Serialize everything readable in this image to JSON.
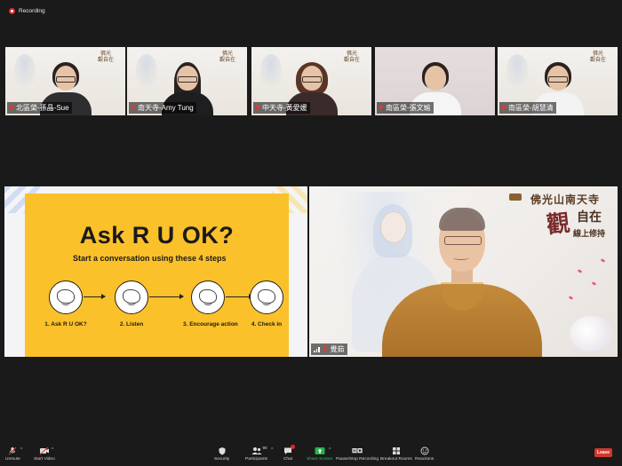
{
  "recording": {
    "label": "Recording"
  },
  "thumbnails": [
    {
      "name": "北區榮-孫晶-Sue"
    },
    {
      "name": "南天寺-Amy Tung"
    },
    {
      "name": "中天寺-黃愛媛"
    },
    {
      "name": "南區榮-張文瑜"
    },
    {
      "name": "南區榮-胡慧清"
    }
  ],
  "share": {
    "title": "Ask R U OK?",
    "subtitle": "Start a  conversation using these 4 steps",
    "steps": [
      {
        "label": "1. Ask R U OK?"
      },
      {
        "label": "2. Listen"
      },
      {
        "label": "3. Encourage action"
      },
      {
        "label": "4. Check in"
      }
    ]
  },
  "speaker": {
    "name": "覺茹",
    "logo_line1": "佛光山南天寺",
    "big_char": "觀",
    "calligraphy_2": "自在",
    "calligraphy_3": "線上修持"
  },
  "toolbar": {
    "unmute": "Unmute",
    "start_video": "Start Video",
    "security": "Security",
    "participants": "Participants",
    "participants_count": "90",
    "chat": "Chat",
    "share_screen": "Share Screen",
    "pause_stop": "Pause/Stop Recording",
    "breakout": "Breakout Rooms",
    "reactions": "Reactions",
    "leave": "Leave"
  },
  "colors": {
    "card_yellow": "#fbc12a",
    "record_red": "#e02828",
    "share_green": "#23b24b",
    "leave_red": "#d0382f"
  }
}
